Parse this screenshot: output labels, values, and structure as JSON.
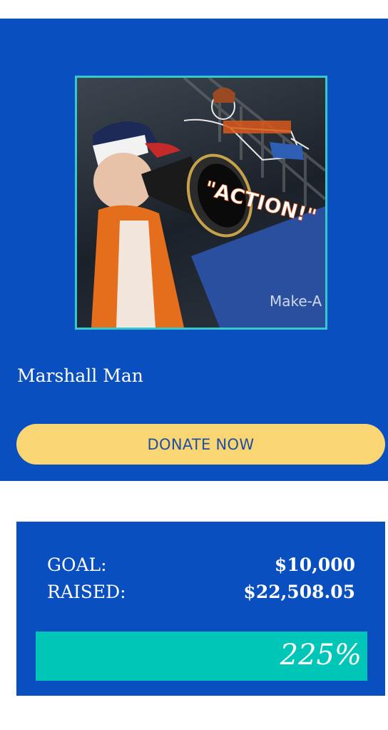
{
  "campaign": {
    "name": "Marshall Man",
    "photo_caption": "\"ACTION!\"",
    "photo_banner_text": "Make-A"
  },
  "donate": {
    "label": "DONATE NOW"
  },
  "stats": {
    "goal_label": "GOAL:",
    "goal_value": "$10,000",
    "raised_label": "RAISED:",
    "raised_value": "$22,508.05",
    "percent_label": "225%",
    "progress_fraction": 1.0
  },
  "colors": {
    "brand_blue": "#0a4fbf",
    "donate_yellow": "#f9d673",
    "progress_teal": "#00c6b8",
    "frame_teal": "#33c9cf"
  }
}
